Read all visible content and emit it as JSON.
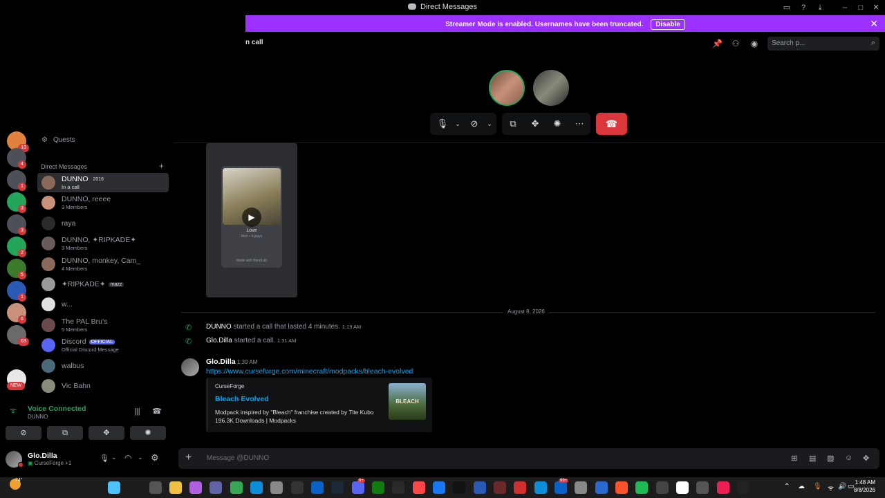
{
  "window": {
    "title": "Direct Messages"
  },
  "banner": {
    "text": "Streamer Mode is enabled. Usernames have been truncated.",
    "disable_label": "Disable"
  },
  "call_header": {
    "label": "n call"
  },
  "search": {
    "placeholder": "Search p..."
  },
  "servers": [
    {
      "badge": "13",
      "color": "#e0823d"
    },
    {
      "badge": "4",
      "color": "#4e5058"
    },
    {
      "badge": "1",
      "color": "#4e5058"
    },
    {
      "badge": "3",
      "color": "#23a55a"
    },
    {
      "badge": "3",
      "color": "#4e5058"
    },
    {
      "badge": "2",
      "color": "#23a55a"
    },
    {
      "badge": "5",
      "color": "#3a7a2a"
    },
    {
      "badge": "1",
      "color": "#2a5ab5"
    },
    {
      "badge": "6",
      "color": "#c9917a"
    },
    {
      "badge": "63",
      "color": "#6a6a6a"
    },
    {
      "badge": "",
      "color": "#000000"
    },
    {
      "badge": "NEW",
      "color": "#e8e8e8"
    }
  ],
  "sidebar": {
    "quests_label": "Quests",
    "dm_header": "Direct Messages",
    "add_dm": "+",
    "dms": [
      {
        "name": "DUNNO",
        "sub": "In a call",
        "tag": "2016",
        "active": true
      },
      {
        "name": "DUNNO, reeee",
        "sub": "3 Members"
      },
      {
        "name": "raya",
        "sub": ""
      },
      {
        "name": "DUNNO, ✦RIPKADE✦",
        "sub": "3 Members"
      },
      {
        "name": "DUNNO, monkey, Cam_",
        "sub": "4 Members"
      },
      {
        "name": "✦RIPKADE✦",
        "sub": "",
        "tag": "mazz"
      },
      {
        "name": "w...",
        "sub": ""
      },
      {
        "name": "The PAL Bru's",
        "sub": "5 Members"
      },
      {
        "name": "Discord",
        "sub": "Official Discord Message",
        "tag": "OFFICIAL"
      },
      {
        "name": "walbus",
        "sub": ""
      },
      {
        "name": "Vic Bahn",
        "sub": ""
      }
    ]
  },
  "voice": {
    "status": "Voice Connected",
    "channel": "DUNNO"
  },
  "user": {
    "name": "Glo.Dilla",
    "status": "CurseForge +1"
  },
  "chat": {
    "video": {
      "title": "Love",
      "meta": "Rich • 4 plays",
      "footer": "Made with BandLab"
    },
    "date_divider": "August 8, 2026",
    "system_messages": [
      {
        "author": "DUNNO",
        "text": "started a call that lasted 4 minutes.",
        "time": "1:19 AM"
      },
      {
        "author": "Glo.Dilla",
        "text": "started a call.",
        "time": "1:31 AM"
      }
    ],
    "message": {
      "author": "Glo.Dilla",
      "time": "1:39 AM",
      "link": "https://www.curseforge.com/minecraft/modpacks/bleach-evolved",
      "embed": {
        "provider": "CurseForge",
        "title": "Bleach Evolved",
        "description": "Modpack inspired by \"Bleach\" franchise created by Tite Kubo",
        "stats": "196.3K Downloads | Modpacks",
        "thumb_text": "BLEACH"
      }
    },
    "composer_placeholder": "Message @DUNNO"
  },
  "taskbar": {
    "weather": "74°",
    "time": "1:48 AM",
    "date": "8/8/2026",
    "badges": {
      "discord": "9+",
      "outlook": "99+"
    }
  },
  "colors": {
    "banner": "#9b30ff",
    "hangup": "#da373c",
    "online": "#23a55a",
    "link": "#00a8fc",
    "accent": "#5865f2"
  }
}
